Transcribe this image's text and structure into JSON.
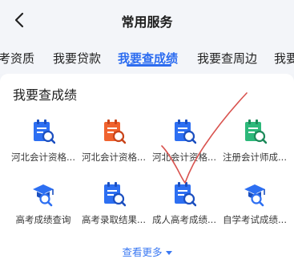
{
  "header": {
    "title": "常用服务"
  },
  "tabs": [
    {
      "label": "考资质"
    },
    {
      "label": "我要贷款"
    },
    {
      "label": "我要查成绩",
      "active": true
    },
    {
      "label": "我要查周边"
    },
    {
      "label": "我要"
    }
  ],
  "section": {
    "title": "我要查成绩"
  },
  "items": [
    {
      "label": "河北会计资格...",
      "icon": "score-search-icon",
      "color": "#2d6ff2"
    },
    {
      "label": "河北会计资格...",
      "icon": "score-search-icon",
      "color": "#f0632f"
    },
    {
      "label": "河北会计资格...",
      "icon": "score-search-icon",
      "color": "#2d6ff2"
    },
    {
      "label": "注册会计师成...",
      "icon": "score-search-icon",
      "color": "#2db87a"
    },
    {
      "label": "高考成绩查询",
      "icon": "graduation-cap-search-icon",
      "color": "#2d6ff2"
    },
    {
      "label": "高考录取结果...",
      "icon": "score-search-icon",
      "color": "#2d6ff2"
    },
    {
      "label": "成人高考成绩...",
      "icon": "score-search-icon",
      "color": "#2d6ff2"
    },
    {
      "label": "自学考试成绩...",
      "icon": "graduation-cap-search-icon",
      "color": "#2d6ff2"
    }
  ],
  "more": {
    "label": "查看更多"
  },
  "colors": {
    "accent": "#2c6cf0",
    "check_mark": "#d9534f"
  }
}
